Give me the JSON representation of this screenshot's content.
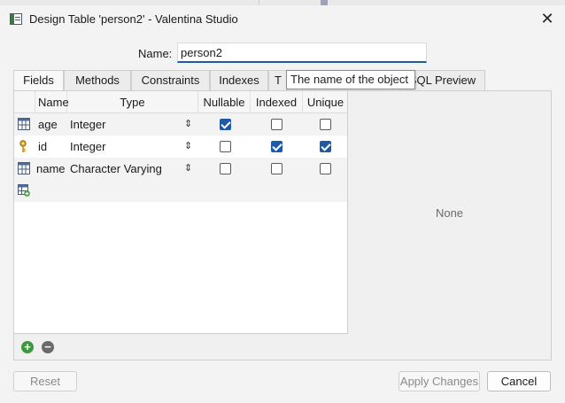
{
  "window": {
    "title": "Design Table 'person2' - Valentina Studio",
    "close_glyph": "✕"
  },
  "name_field": {
    "label": "Name:",
    "value": "person2"
  },
  "tabs": [
    {
      "label": "Fields",
      "active": true
    },
    {
      "label": "Methods",
      "active": false
    },
    {
      "label": "Constraints",
      "active": false
    },
    {
      "label": "Indexes",
      "active": false
    },
    {
      "label": "T",
      "active": false
    },
    {
      "label": "SQL Preview",
      "active": false
    }
  ],
  "tooltip": "The name of the object",
  "grid": {
    "columns": [
      "Name",
      "Type",
      "Nullable",
      "Indexed",
      "Unique"
    ],
    "rows": [
      {
        "icon": "table-field-icon",
        "name": "age",
        "type": "Integer",
        "nullable": true,
        "indexed": false,
        "unique": false
      },
      {
        "icon": "key-icon",
        "name": "id",
        "type": "Integer",
        "nullable": false,
        "indexed": true,
        "unique": true
      },
      {
        "icon": "table-field-icon",
        "name": "name",
        "type": "Character Varying",
        "nullable": false,
        "indexed": false,
        "unique": false
      }
    ],
    "new_row_icon": "add-field-icon"
  },
  "right_panel": {
    "text": "None"
  },
  "toolbar": {
    "add_icon": "plus-circle-icon",
    "remove_icon": "minus-circle-icon"
  },
  "buttons": {
    "reset": "Reset",
    "apply": "Apply Changes",
    "cancel": "Cancel"
  },
  "colors": {
    "accent": "#1f5aa8",
    "add": "#3c9a3c"
  }
}
